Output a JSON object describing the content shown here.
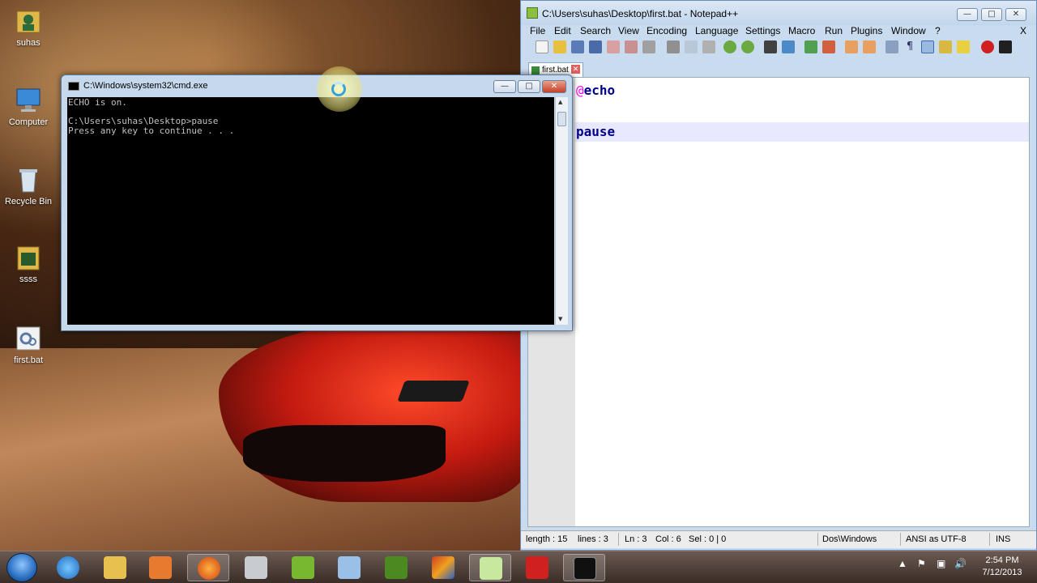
{
  "desktop": {
    "icons": [
      {
        "label": "suhas"
      },
      {
        "label": "Computer"
      },
      {
        "label": "Recycle Bin"
      },
      {
        "label": "ssss"
      },
      {
        "label": "first.bat"
      }
    ]
  },
  "notepad": {
    "title": "C:\\Users\\suhas\\Desktop\\first.bat - Notepad++",
    "menu": [
      "File",
      "Edit",
      "Search",
      "View",
      "Encoding",
      "Language",
      "Settings",
      "Macro",
      "Run",
      "Plugins",
      "Window",
      "?"
    ],
    "menu_close": "X",
    "tab_label": "first.bat",
    "lines": [
      {
        "prefix": "@",
        "text": "echo"
      },
      {
        "prefix": "",
        "text": ""
      },
      {
        "prefix": "",
        "text": "pause"
      }
    ],
    "status": {
      "length": "length : 15",
      "lines": "lines : 3",
      "ln": "Ln : 3",
      "col": "Col : 6",
      "sel": "Sel : 0 | 0",
      "eol": "Dos\\Windows",
      "encoding": "ANSI as UTF-8",
      "mode": "INS"
    }
  },
  "cmd": {
    "title": "C:\\Windows\\system32\\cmd.exe",
    "output": "ECHO is on.\n\nC:\\Users\\suhas\\Desktop>pause\nPress any key to continue . . ."
  },
  "taskbar": {
    "time": "2:54 PM",
    "date": "7/12/2013"
  },
  "colors": {
    "keyword": "#00008b",
    "at_symbol": "#ff00ff",
    "current_line": "#e8e8ff"
  }
}
